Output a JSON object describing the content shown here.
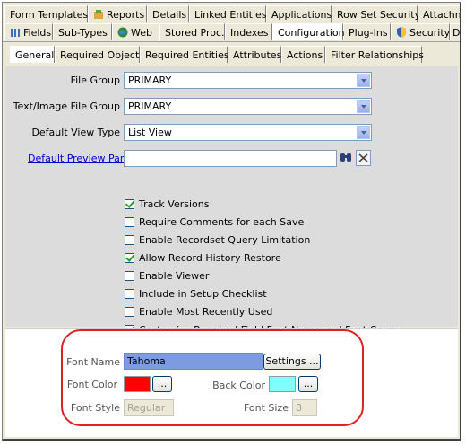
{
  "tabs_row1": [
    {
      "label": "Form Templates",
      "icon": ""
    },
    {
      "label": "Reports",
      "icon": "reports-icon"
    },
    {
      "label": "Details",
      "icon": ""
    },
    {
      "label": "Linked Entities",
      "icon": ""
    },
    {
      "label": "Applications",
      "icon": ""
    },
    {
      "label": "Row Set Security",
      "icon": ""
    },
    {
      "label": "Attachme",
      "icon": ""
    }
  ],
  "tabs_row2": [
    {
      "label": "Fields",
      "icon": "fields-icon"
    },
    {
      "label": "Sub-Types",
      "icon": ""
    },
    {
      "label": "Web",
      "icon": "web-globe-icon"
    },
    {
      "label": "Stored Proc.",
      "icon": ""
    },
    {
      "label": "Indexes",
      "icon": ""
    },
    {
      "label": "Configuration",
      "icon": ""
    },
    {
      "label": "Plug-Ins",
      "icon": ""
    },
    {
      "label": "Security",
      "icon": "security-shield-icon"
    },
    {
      "label": "D",
      "icon": ""
    }
  ],
  "tabs_row3": [
    {
      "label": "General"
    },
    {
      "label": "Required Objects"
    },
    {
      "label": "Required Entities"
    },
    {
      "label": "Attributes"
    },
    {
      "label": "Actions"
    },
    {
      "label": "Filter Relationships"
    }
  ],
  "fields": {
    "file_group_label": "File Group",
    "file_group_value": "PRIMARY",
    "text_image_label": "Text/Image File Group",
    "text_image_value": "PRIMARY",
    "view_type_label": "Default View Type",
    "view_type_value": "List View",
    "preview_pane_label": "Default Preview Pane",
    "preview_pane_value": ""
  },
  "checkboxes": [
    {
      "label": "Track Versions",
      "checked": true
    },
    {
      "label": "Require Comments for each Save",
      "checked": false
    },
    {
      "label": "Enable Recordset Query Limitation",
      "checked": false
    },
    {
      "label": "Allow Record History Restore",
      "checked": true
    },
    {
      "label": "Enable Viewer",
      "checked": false
    },
    {
      "label": "Include in Setup Checklist",
      "checked": false
    },
    {
      "label": "Enable Most Recently Used",
      "checked": false
    },
    {
      "label": "Customize Required Field Font Name and Font Color",
      "checked": true
    }
  ],
  "font": {
    "name_label": "Font Name",
    "name_value": "Tahoma",
    "settings_label": "Settings ...",
    "color_label": "Font Color",
    "color_hex": "#ff0000",
    "back_color_label": "Back Color",
    "back_color_hex": "#80ffff",
    "ellipsis": "...",
    "style_label": "Font Style",
    "style_value": "Regular",
    "size_label": "Font Size",
    "size_value": "8"
  },
  "colors": {
    "font_name_highlight": "#7d9be0",
    "annotation_ring": "#e02020"
  }
}
